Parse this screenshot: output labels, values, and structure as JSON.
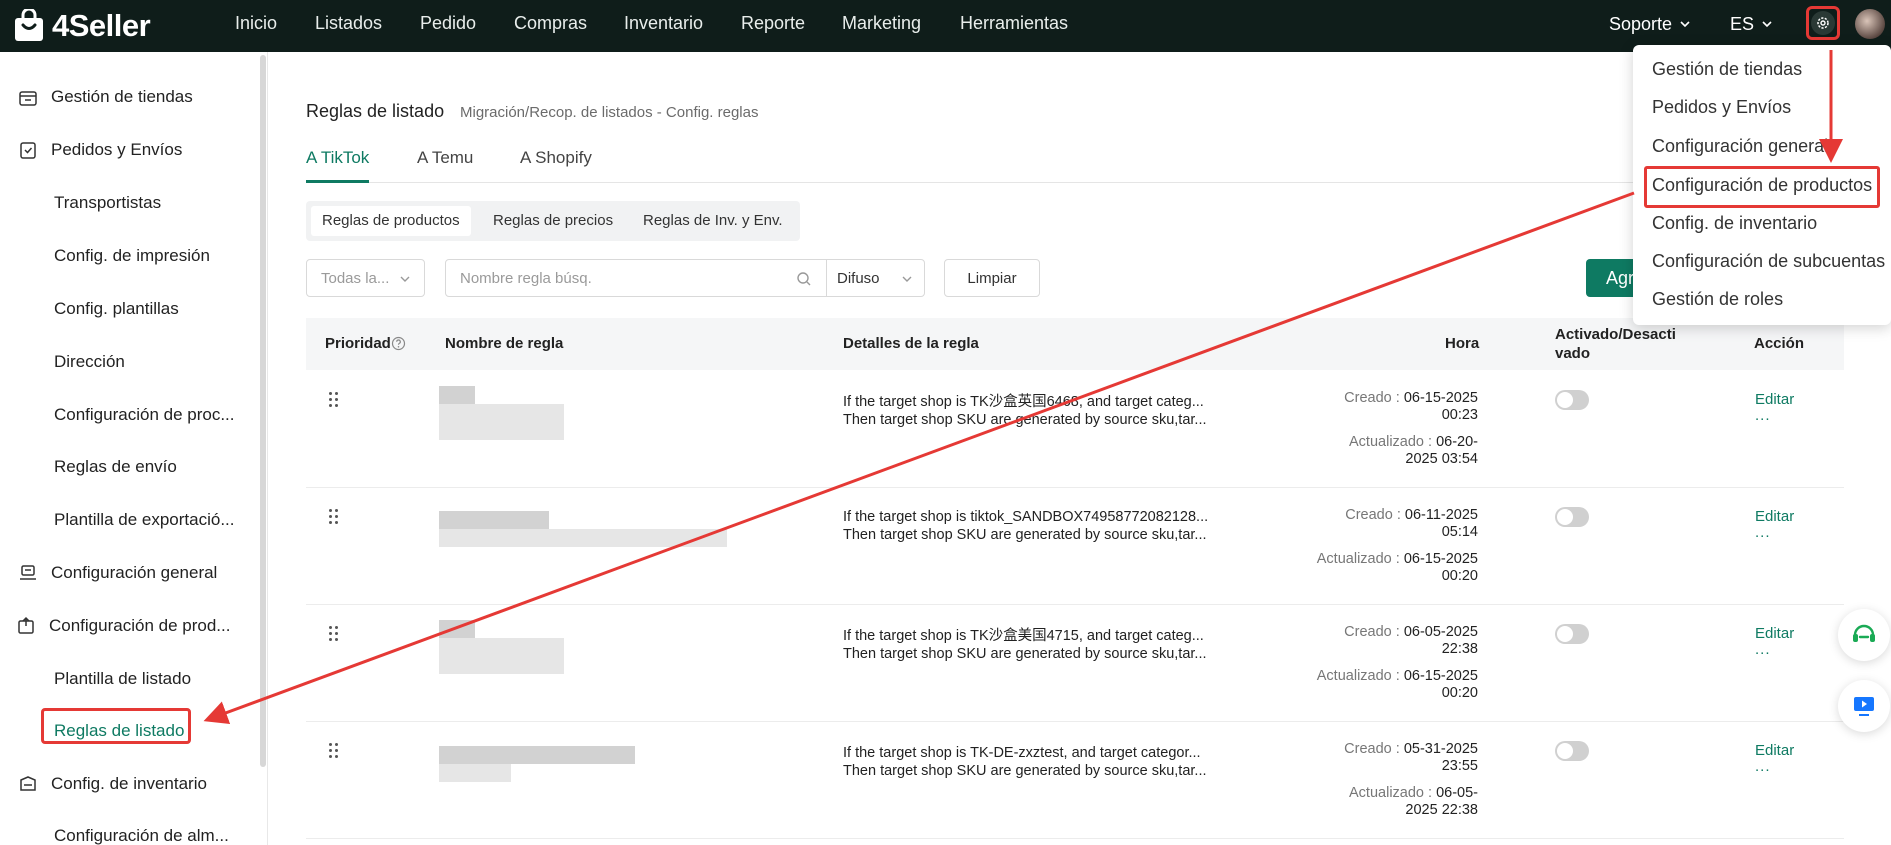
{
  "app": {
    "brand": "4Seller"
  },
  "topnav": {
    "items": [
      "Inicio",
      "Listados",
      "Pedido",
      "Compras",
      "Inventario",
      "Reporte",
      "Marketing",
      "Herramientas"
    ],
    "support": "Soporte",
    "language": "ES"
  },
  "sidebar": {
    "items": [
      "Gestión de tiendas",
      "Pedidos y Envíos",
      "Transportistas",
      "Config. de impresión",
      "Config. plantillas",
      "Dirección",
      "Configuración de proc...",
      "Reglas de envío",
      "Plantilla de exportació...",
      "Configuración general",
      "Configuración de prod...",
      "Plantilla de listado",
      "Reglas de listado",
      "Config. de inventario",
      "Configuración de alm..."
    ]
  },
  "page": {
    "title": "Reglas de listado",
    "breadcrumb": "Migración/Recop. de listados - Config. reglas",
    "tabs": [
      "A TikTok",
      "A Temu",
      "A Shopify"
    ],
    "subtabs": [
      "Reglas de productos",
      "Reglas de precios",
      "Reglas de Inv. y Env."
    ]
  },
  "filters": {
    "shop_select": "Todas la...",
    "search_placeholder": "Nombre regla búsq.",
    "match_select": "Difuso",
    "clear_button": "Limpiar",
    "add_button": "Agr"
  },
  "table": {
    "headers": {
      "priority": "Prioridad",
      "name": "Nombre de regla",
      "details": "Detalles de la regla",
      "time": "Hora",
      "enabled": "Activado/Desactivado",
      "enabled_line1": "Activado/Desacti",
      "enabled_line2": "vado",
      "action": "Acción"
    },
    "created_label": "Creado : ",
    "updated_label": "Actualizado : ",
    "edit_label": "Editar",
    "more_label": "...",
    "rows": [
      {
        "detail_1": "If the target shop is TK沙盒英国6468, and target categ...",
        "detail_2": "Then target shop SKU are generated by source sku,tar...",
        "created_1": "06-15-2025",
        "created_2": "00:23",
        "updated_1": "06-20-",
        "updated_2": "2025 03:54",
        "enabled": false
      },
      {
        "detail_1": "If the target shop is tiktok_SANDBOX74958772082128...",
        "detail_2": "Then target shop SKU are generated by source sku,tar...",
        "created_1": "06-11-2025",
        "created_2": "05:14",
        "updated_1": "06-15-2025",
        "updated_2": "00:20",
        "enabled": false
      },
      {
        "detail_1": "If the target shop is TK沙盒美国4715, and target categ...",
        "detail_2": "Then target shop SKU are generated by source sku,tar...",
        "created_1": "06-05-2025",
        "created_2": "22:38",
        "updated_1": "06-15-2025",
        "updated_2": "00:20",
        "enabled": false
      },
      {
        "detail_1": "If the target shop is TK-DE-zxztest, and target categor...",
        "detail_2": "Then target shop SKU are generated by source sku,tar...",
        "created_1": "05-31-2025",
        "created_2": "23:55",
        "updated_1": "06-05-",
        "updated_2": "2025 22:38",
        "enabled": false
      }
    ]
  },
  "settings_menu": {
    "items": [
      "Gestión de tiendas",
      "Pedidos y Envíos",
      "Configuración general",
      "Configuración de productos",
      "Config. de inventario",
      "Configuración de subcuentas",
      "Gestión de roles"
    ]
  },
  "colors": {
    "accent": "#0e7a62",
    "annotation": "#e53935",
    "topbar": "#0f1d1a"
  }
}
